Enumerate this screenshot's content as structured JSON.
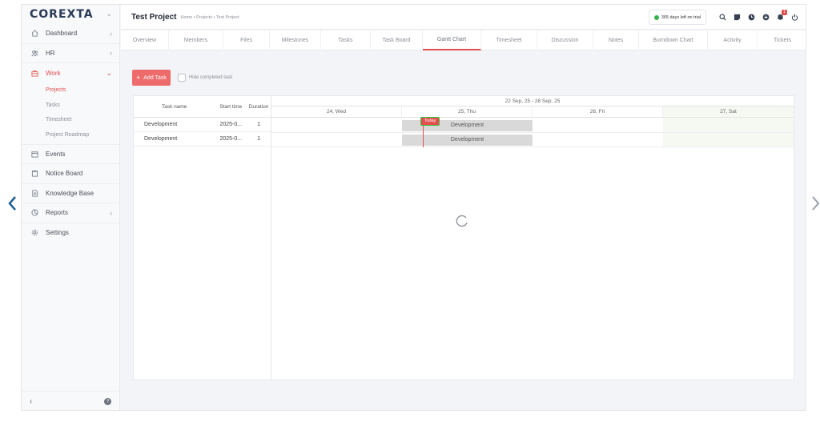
{
  "app": {
    "logo": "COREXTA"
  },
  "sidebar": {
    "items": [
      {
        "label": "Dashboard",
        "icon": "home-icon",
        "has_chevron": true
      },
      {
        "label": "HR",
        "icon": "users-icon",
        "has_chevron": true
      },
      {
        "label": "Work",
        "icon": "briefcase-icon",
        "has_chevron": true,
        "active": true
      },
      {
        "label": "Events",
        "icon": "calendar-icon"
      },
      {
        "label": "Notice Board",
        "icon": "clipboard-icon"
      },
      {
        "label": "Knowledge Base",
        "icon": "book-icon"
      },
      {
        "label": "Reports",
        "icon": "chart-pie-icon",
        "has_chevron": true
      },
      {
        "label": "Settings",
        "icon": "gear-icon"
      }
    ],
    "work_submenu": [
      "Projects",
      "Tasks",
      "Timesheet",
      "Project Roadmap"
    ],
    "active_submenu": "Projects"
  },
  "header": {
    "title": "Test Project",
    "breadcrumb": "Home • Projects • Test Project",
    "trial_text": "365 days left on trial",
    "notification_count": "1"
  },
  "tabs": [
    "Overview",
    "Members",
    "Files",
    "Milestones",
    "Tasks",
    "Task Board",
    "Gantt Chart",
    "Timesheet",
    "Discussion",
    "Notes",
    "Burndown Chart",
    "Activity",
    "Tickets"
  ],
  "active_tab": "Gantt Chart",
  "toolbar": {
    "add_task_label": "Add Task",
    "hide_completed_label": "Hide completed task"
  },
  "gantt": {
    "columns": [
      "Task name",
      "Start time",
      "Duration"
    ],
    "rows": [
      {
        "name": "Development",
        "start": "2025-0...",
        "duration": "1",
        "bar_label": "Development"
      },
      {
        "name": "Development",
        "start": "2025-0...",
        "duration": "1",
        "bar_label": "Development"
      }
    ],
    "range_label": "22 Sep, 25 - 28 Sep, 25",
    "days": [
      "24, Wed",
      "25, Thu",
      "26, Fri",
      "27, Sat"
    ],
    "today_label": "Today"
  },
  "colors": {
    "accent": "#e14f4f",
    "trial_dot": "#33b34d",
    "today_border": "#36c23a"
  }
}
